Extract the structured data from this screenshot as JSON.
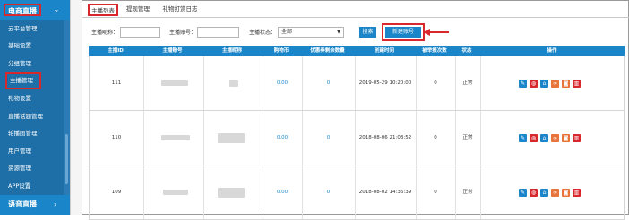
{
  "sidebar": {
    "header_title": "电商直播",
    "items": [
      {
        "label": "云平台管理"
      },
      {
        "label": "基础设置"
      },
      {
        "label": "分组管理"
      },
      {
        "label": "主播管理",
        "active": true
      },
      {
        "label": "礼物设置"
      },
      {
        "label": "直播话题管理"
      },
      {
        "label": "轮播图管理"
      },
      {
        "label": "用户管理"
      },
      {
        "label": "资源管理"
      },
      {
        "label": "APP设置"
      }
    ],
    "footer_title": "语音直播"
  },
  "tabs": [
    {
      "label": "主播列表",
      "active": true
    },
    {
      "label": "提现管理"
    },
    {
      "label": "礼物打赏日志"
    }
  ],
  "filters": {
    "anchor_nick_label": "主播昵称：",
    "anchor_account_label": "主播账号：",
    "anchor_status_label": "主播状态：",
    "status_value": "全部",
    "search_label": "搜索",
    "new_account_label": "新建账号"
  },
  "table": {
    "columns": [
      "主播ID",
      "主播账号",
      "主播昵称",
      "购物币",
      "优惠券剩余数量",
      "创建时间",
      "被举报次数",
      "状态",
      "操作"
    ],
    "rows": [
      {
        "id": "111",
        "coins": "0.00",
        "coupons": "0",
        "created": "2019-05-29 10:20:00",
        "reports": "0",
        "status": "正常"
      },
      {
        "id": "110",
        "coins": "0.00",
        "coupons": "0",
        "created": "2018-08-06 21:03:52",
        "reports": "0",
        "status": "正常"
      },
      {
        "id": "109",
        "coins": "0.00",
        "coupons": "0",
        "created": "2018-08-02 14:36:39",
        "reports": "0",
        "status": "正常"
      }
    ]
  },
  "colors": {
    "sidebar_bg": "#1e6fa8",
    "accent_blue": "#1a86c9",
    "highlight_red": "#d9272e",
    "icon_orange": "#e8743b"
  },
  "action_icons": [
    "edit-icon",
    "lock-icon",
    "home-icon",
    "link-icon",
    "camera-icon",
    "delete-icon"
  ]
}
